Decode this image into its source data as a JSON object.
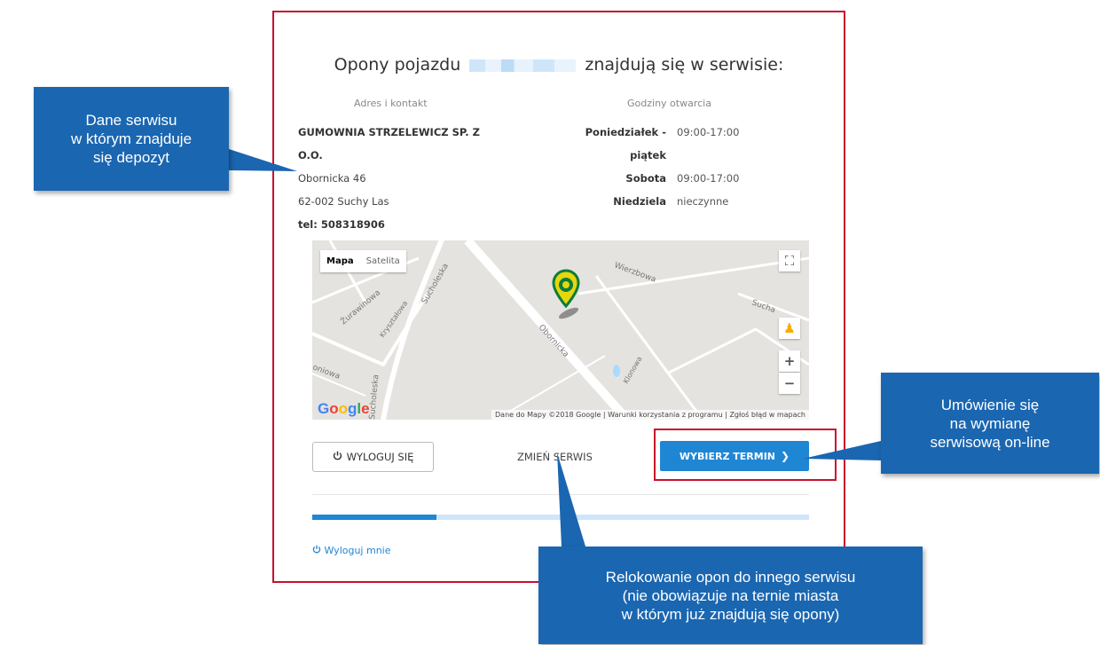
{
  "title_before": "Opony pojazdu",
  "title_after": "znajdują się w serwisie:",
  "address": {
    "heading": "Adres i kontakt",
    "name_line1": "GUMOWNIA STRZELEWICZ SP. Z",
    "name_line2": "O.O.",
    "street": "Obornicka 46",
    "city": "62-002 Suchy Las",
    "phone": "tel: 508318906"
  },
  "hours": {
    "heading": "Godziny otwarcia",
    "rows": [
      {
        "day": "Poniedziałek - piątek",
        "time": "09:00-17:00"
      },
      {
        "day": "Sobota",
        "time": "09:00-17:00"
      },
      {
        "day": "Niedziela",
        "time": "nieczynne"
      }
    ]
  },
  "map": {
    "tab_map": "Mapa",
    "tab_satellite": "Satelita",
    "footer": "Dane do Mapy ©2018 Google  |  Warunki korzystania z programu  |  Zgłoś błąd w mapach",
    "streets": [
      "Żurawinowa",
      "Kryształowa",
      "Sucholeska",
      "Obornicka",
      "Wierzbowa",
      "Klonowa",
      "Sucha",
      "Sucholeska",
      "oniowa"
    ],
    "google": [
      "G",
      "o",
      "o",
      "g",
      "l",
      "e"
    ],
    "google_colors": [
      "#4285f4",
      "#ea4335",
      "#fbbc05",
      "#4285f4",
      "#34a853",
      "#ea4335"
    ]
  },
  "buttons": {
    "logout": "WYLOGUJ SIĘ",
    "change_service": "ZMIEŃ SERWIS",
    "choose_date": "WYBIERZ TERMIN"
  },
  "progress_fraction": 0.25,
  "logout_link": "Wyloguj mnie",
  "callouts": {
    "left_lines": [
      "Dane serwisu",
      "w którym znajduje",
      "się depozyt"
    ],
    "right_lines": [
      "Umówienie się",
      "na wymianę",
      "serwisową on-line"
    ],
    "bottom_lines": [
      "Relokowanie opon do innego serwisu",
      "(nie obowiązuje na ternie miasta",
      "w którym już znajdują się opony)"
    ]
  },
  "colors": {
    "accent": "#1f86d4",
    "callout": "#1a66b1",
    "highlight": "#c8102e"
  }
}
